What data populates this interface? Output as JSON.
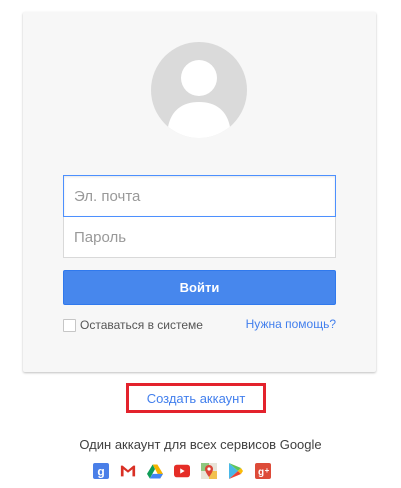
{
  "login": {
    "email_placeholder": "Эл. почта",
    "password_placeholder": "Пароль",
    "signin_label": "Войти",
    "stay_signed_in_label": "Оставаться в системе",
    "help_link": "Нужна помощь?"
  },
  "footer": {
    "create_account_label": "Создать аккаунт",
    "tagline": "Один аккаунт для всех сервисов Google",
    "services": [
      "google-search-icon",
      "gmail-icon",
      "drive-icon",
      "youtube-icon",
      "maps-icon",
      "play-icon",
      "google-plus-icon"
    ]
  },
  "colors": {
    "accent": "#4787ed",
    "link": "#427fed",
    "highlight_border": "#e3222c",
    "card_background": "#f7f7f7"
  }
}
